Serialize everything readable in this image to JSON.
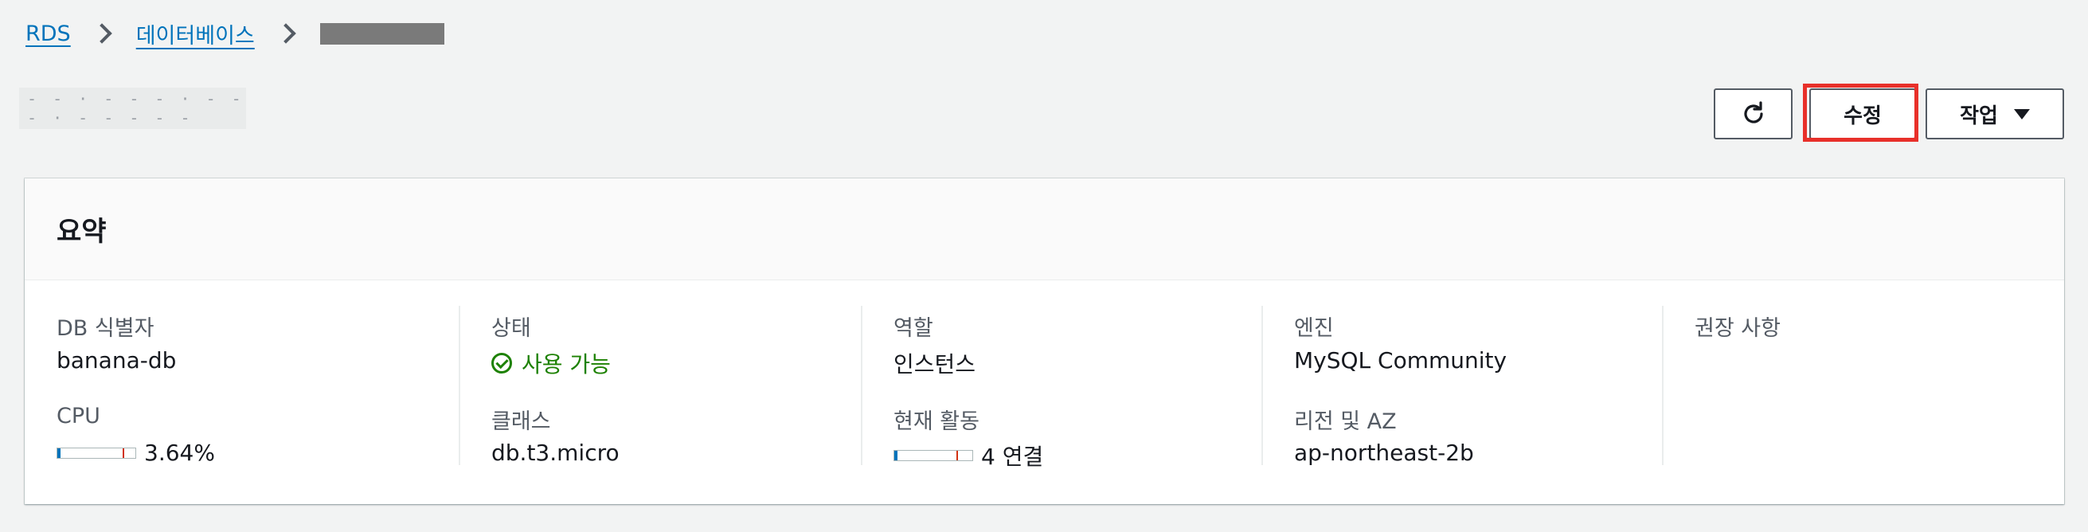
{
  "breadcrumb": {
    "root": "RDS",
    "databases": "데이터베이스"
  },
  "page": {
    "title": "- - · - - - · - - - · -   - - - -"
  },
  "actions": {
    "modify": "수정",
    "actions": "작업"
  },
  "summary": {
    "title": "요약",
    "db_identifier": {
      "label": "DB 식별자",
      "value": "banana-db"
    },
    "cpu": {
      "label": "CPU",
      "value": "3.64%",
      "fill": 0.0364
    },
    "status": {
      "label": "상태",
      "value": "사용 가능"
    },
    "class": {
      "label": "클래스",
      "value": "db.t3.micro"
    },
    "role": {
      "label": "역할",
      "value": "인스턴스"
    },
    "activity": {
      "label": "현재 활동",
      "value": "4 연결",
      "fill": 0.04
    },
    "engine": {
      "label": "엔진",
      "value": "MySQL Community"
    },
    "region": {
      "label": "리전 및 AZ",
      "value": "ap-northeast-2b"
    },
    "recommendations": {
      "label": "권장 사항"
    }
  },
  "colors": {
    "link": "#0073bb",
    "success": "#1d8102",
    "highlight": "#e8302a"
  }
}
